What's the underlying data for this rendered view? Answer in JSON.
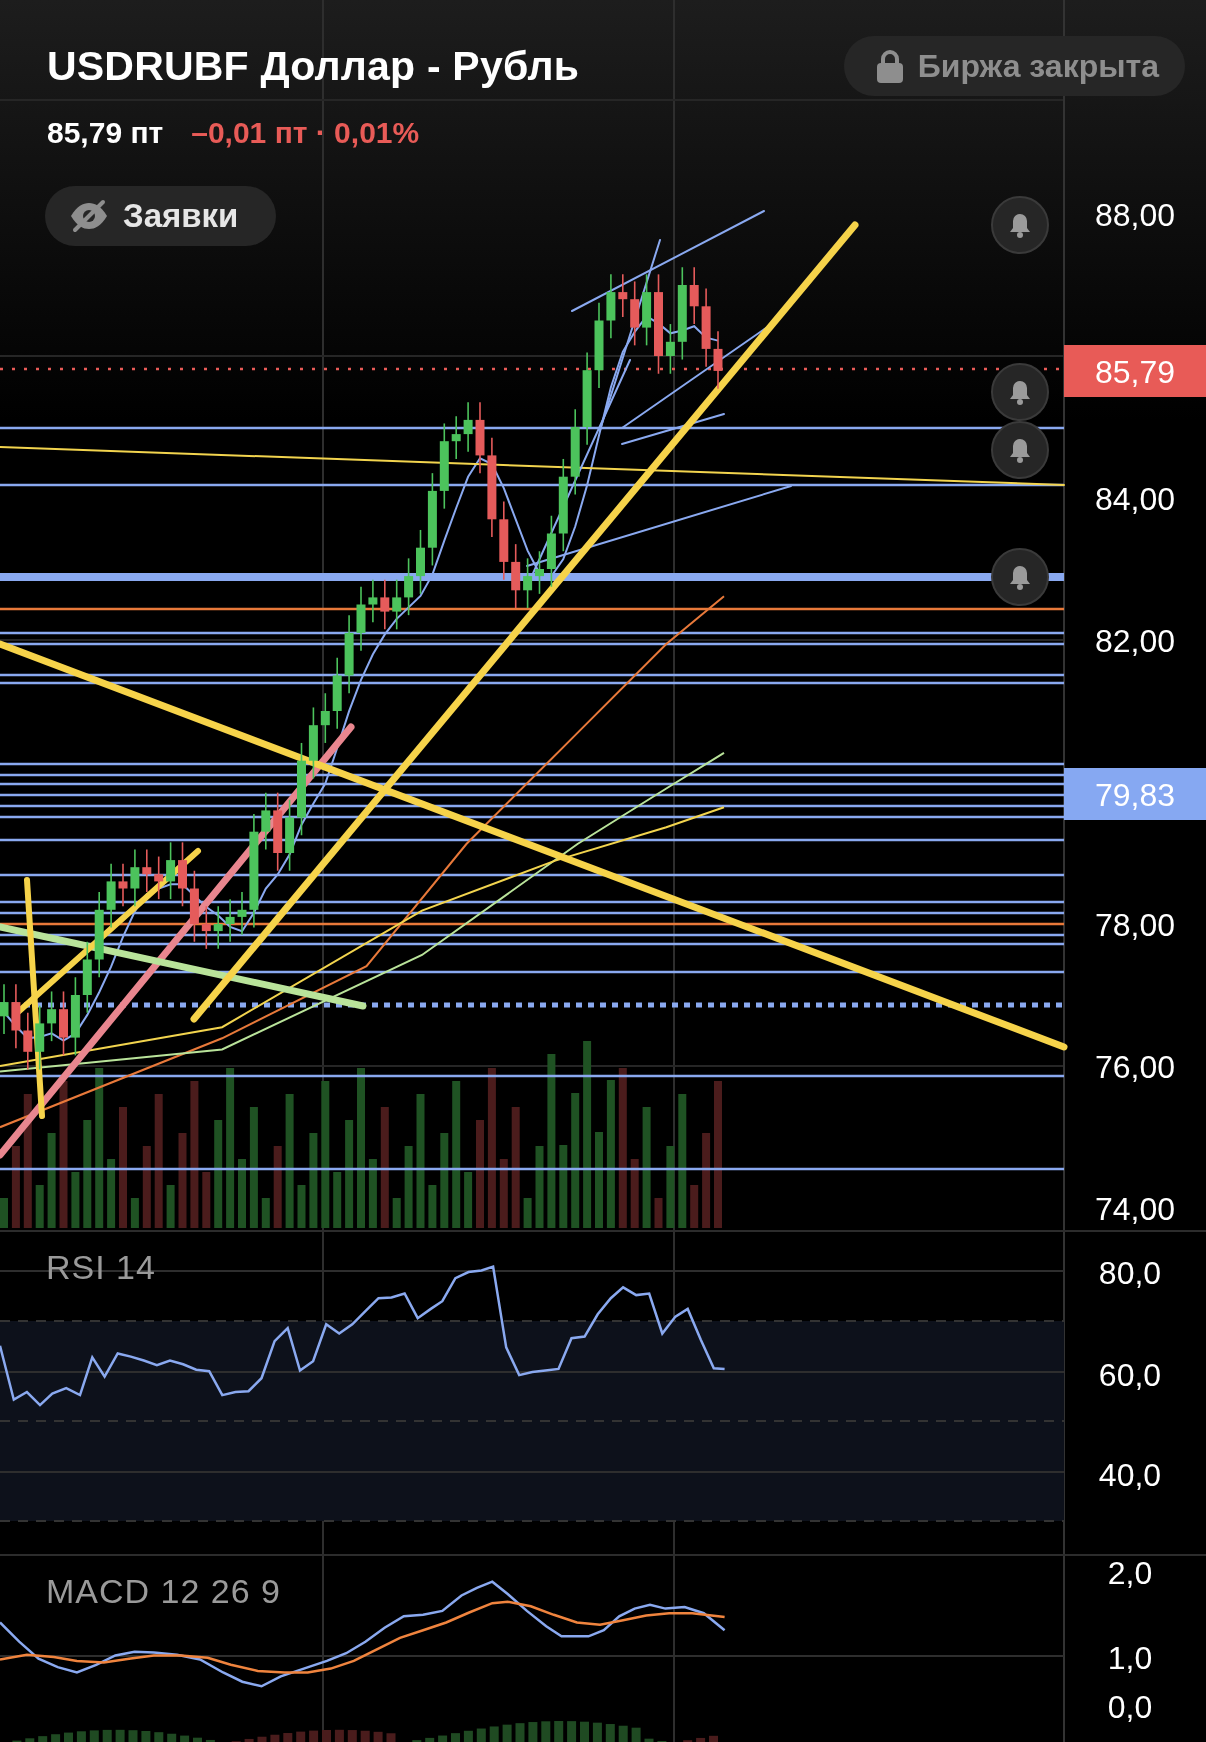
{
  "instrument": {
    "title": "USDRUBF Доллар - Рубль",
    "price": "85,79 пт",
    "change": "–0,01 пт · 0,01%"
  },
  "market_status": {
    "label": "Биржа закрыта"
  },
  "orders_toggle": {
    "label": "Заявки",
    "visible": false
  },
  "price_chart": {
    "y_axis_labels": [
      "88,00",
      "84,00",
      "82,00",
      "78,00",
      "76,00",
      "74,00"
    ],
    "last_price": "85,79",
    "marker_price": "79,83"
  },
  "rsi": {
    "title": "RSI 14",
    "y_axis_labels": [
      "80,0",
      "60,0",
      "40,0"
    ]
  },
  "macd": {
    "title": "MACD 12 26 9",
    "y_axis_labels": [
      "2,0",
      "1,0",
      "0,0"
    ]
  }
}
